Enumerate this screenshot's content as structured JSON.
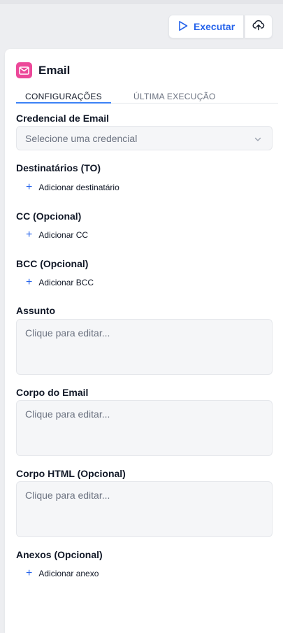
{
  "toolbar": {
    "run_label": "Executar"
  },
  "node": {
    "title": "Email",
    "icon": "mail-icon",
    "accent": "#ec4899"
  },
  "tabs": [
    {
      "label": "CONFIGURAÇÕES",
      "active": true
    },
    {
      "label": "ÚLTIMA EXECUÇÃO",
      "active": false
    }
  ],
  "fields": {
    "credential": {
      "label": "Credencial de Email",
      "placeholder": "Selecione uma credencial"
    },
    "to": {
      "label": "Destinatários (TO)",
      "add_label": "Adicionar destinatário"
    },
    "cc": {
      "label": "CC (Opcional)",
      "add_label": "Adicionar CC"
    },
    "bcc": {
      "label": "BCC (Opcional)",
      "add_label": "Adicionar BCC"
    },
    "subject": {
      "label": "Assunto",
      "placeholder": "Clique para editar..."
    },
    "body": {
      "label": "Corpo do Email",
      "placeholder": "Clique para editar..."
    },
    "html_body": {
      "label": "Corpo HTML (Opcional)",
      "placeholder": "Clique para editar..."
    },
    "attachments": {
      "label": "Anexos (Opcional)",
      "add_label": "Adicionar anexo"
    }
  },
  "colors": {
    "primary": "#2563eb",
    "tab_underline": "#3b82f6"
  }
}
